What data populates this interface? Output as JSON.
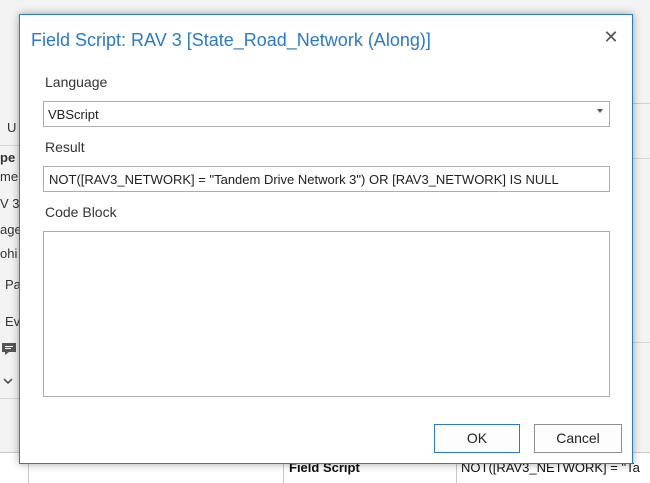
{
  "background": {
    "fragments": [
      "U",
      "pe",
      "me",
      "V 3",
      "age",
      "ohi",
      "Pa",
      "Ev"
    ],
    "table_row": {
      "col_type": "Field Script",
      "col_value": "NOT([RAV3_NETWORK] = \"Ta"
    }
  },
  "dialog": {
    "title": "Field Script: RAV 3 [State_Road_Network (Along)]",
    "close_glyph": "✕",
    "language_label": "Language",
    "language_value": "VBScript",
    "result_label": "Result",
    "result_value": "NOT([RAV3_NETWORK] = \"Tandem Drive Network 3\") OR [RAV3_NETWORK] IS NULL",
    "code_block_label": "Code Block",
    "code_block_value": "",
    "ok_label": "OK",
    "cancel_label": "Cancel"
  },
  "colors": {
    "accent": "#2a7ac4",
    "border": "#adadad"
  }
}
